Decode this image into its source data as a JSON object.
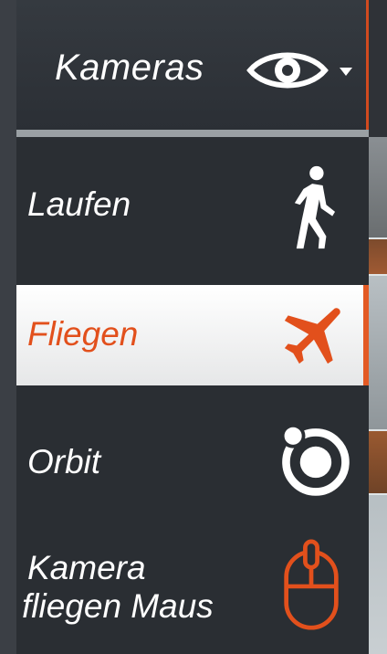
{
  "header": {
    "title": "Kameras",
    "icon": "eye-icon",
    "dropdown_icon": "caret-down-icon"
  },
  "menu": {
    "items": [
      {
        "label": "Laufen",
        "icon": "walking-person-icon",
        "active": false
      },
      {
        "label": "Fliegen",
        "icon": "airplane-icon",
        "active": true
      },
      {
        "label": "Orbit",
        "icon": "orbit-icon",
        "active": false
      },
      {
        "label_line1": "Kamera",
        "label_line2": "fliegen Maus",
        "icon": "mouse-icon",
        "active": false
      }
    ]
  },
  "colors": {
    "accent": "#e2501c",
    "panel": "#2a2e33",
    "active_bg": "#ffffff",
    "text": "#ffffff"
  }
}
